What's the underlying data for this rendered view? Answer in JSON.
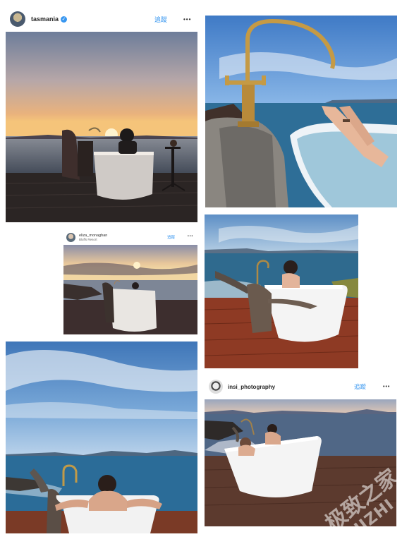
{
  "posts": [
    {
      "username": "tasmania",
      "verified": true,
      "follow_label": "追蹤",
      "more_label": "•••"
    },
    {
      "username": "eliza_monaghan",
      "location": "Bluffs Resort",
      "follow_label": "追蹤",
      "more_label": "•••"
    },
    {
      "username": "insi_photography",
      "follow_label": "追蹤",
      "more_label": "•••"
    }
  ],
  "watermark": {
    "line1": "极致之家",
    "line2": "JIZHI"
  },
  "icons": {
    "verified": "verified-check-icon",
    "more": "more-dots-icon"
  }
}
